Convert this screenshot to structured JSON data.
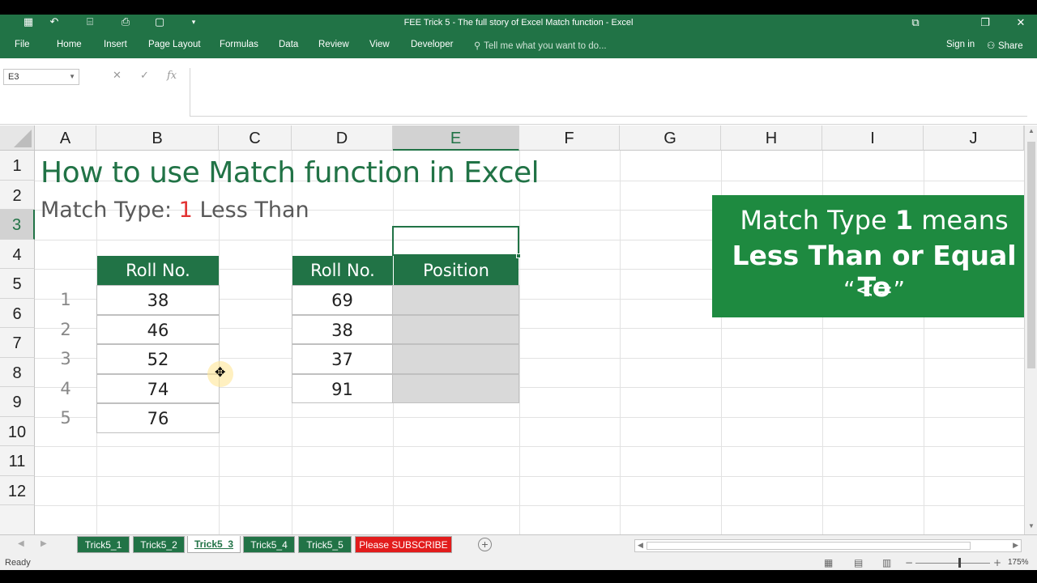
{
  "window": {
    "title": "FEE Trick 5 - The full story of Excel Match function - Excel",
    "restore_label": "⧉",
    "maximize_label": "❐",
    "close_label": "✕",
    "quick_access": [
      "▦",
      "↶",
      "⌸",
      "⎙",
      "▢",
      "▾"
    ]
  },
  "ribbon": {
    "tabs": [
      "File",
      "Home",
      "Insert",
      "Page Layout",
      "Formulas",
      "Data",
      "Review",
      "View",
      "Developer"
    ],
    "tell_me": "Tell me what you want to do...",
    "sign_in": "Sign in",
    "share": "Share"
  },
  "formula_bar": {
    "name_box": "E3",
    "cancel": "✕",
    "enter": "✓",
    "fx": "fx",
    "formula": ""
  },
  "columns": [
    "A",
    "B",
    "C",
    "D",
    "E",
    "F",
    "G",
    "H",
    "I",
    "J"
  ],
  "selected_column": "E",
  "rows": [
    "1",
    "2",
    "3",
    "4",
    "5",
    "6",
    "7",
    "8",
    "9",
    "10",
    "11",
    "12"
  ],
  "selected_row": "3",
  "sheet": {
    "title": "How to use Match function in Excel",
    "subtitle_prefix": "Match Type: ",
    "subtitle_number": "1",
    "subtitle_suffix": " Less Than",
    "index_numbers": [
      "1",
      "2",
      "3",
      "4",
      "5"
    ],
    "table1": {
      "header": "Roll No.",
      "values": [
        "38",
        "46",
        "52",
        "74",
        "76"
      ]
    },
    "table2": {
      "header_roll": "Roll No.",
      "header_position": "Position",
      "values": [
        "69",
        "38",
        "37",
        "91"
      ]
    }
  },
  "callout": {
    "line1_prefix": "Match Type ",
    "line1_bold": "1",
    "line1_suffix": " means",
    "line2": "Less Than or Equal To",
    "line3": "“<=”"
  },
  "sheet_tabs": [
    "Trick5_1",
    "Trick5_2",
    "Trick5_3",
    "Trick5_4",
    "Trick5_5",
    "Please SUBSCRIBE"
  ],
  "active_sheet": "Trick5_3",
  "status": {
    "ready": "Ready",
    "zoom": "175%"
  }
}
